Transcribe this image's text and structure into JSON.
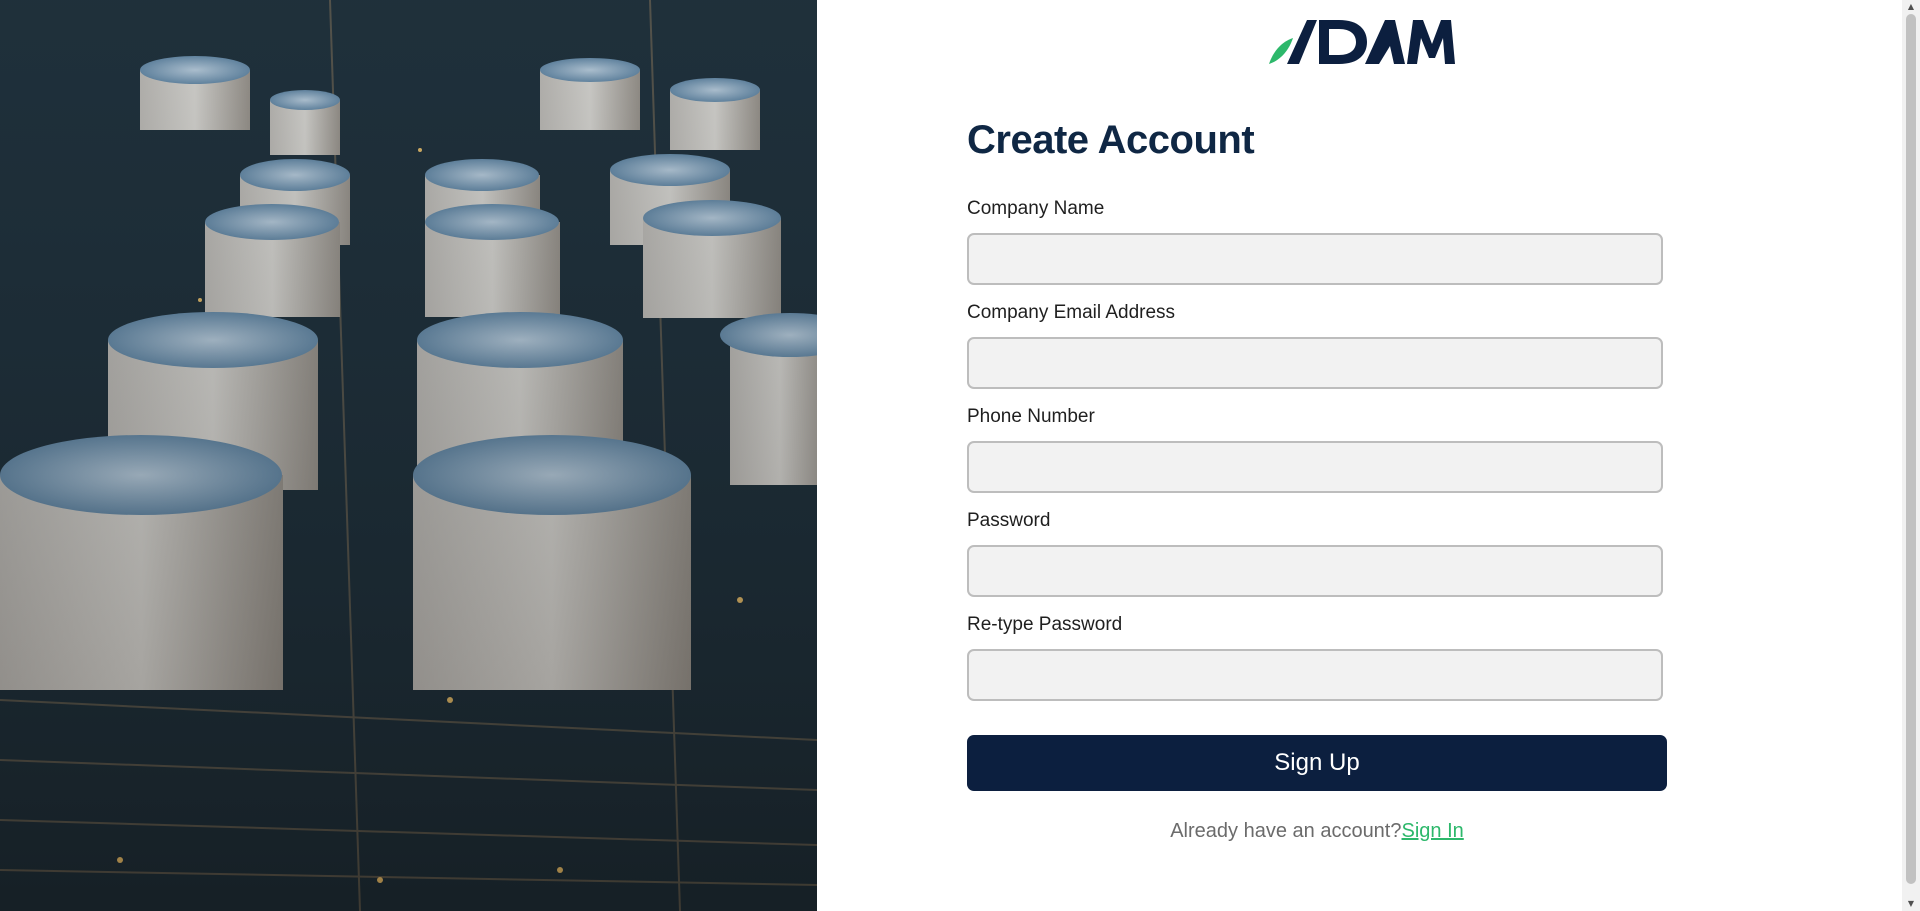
{
  "brand": {
    "logo_text": "ADAM",
    "accent_color": "#2db86b",
    "primary_color": "#0c1f3f"
  },
  "hero": {
    "image": "aerial-oil-storage-tanks-photo"
  },
  "form": {
    "title": "Create Account",
    "fields": [
      {
        "label": "Company Name",
        "value": "",
        "placeholder": ""
      },
      {
        "label": "Company Email Address",
        "value": "",
        "placeholder": ""
      },
      {
        "label": "Phone Number",
        "value": "",
        "placeholder": ""
      },
      {
        "label": "Password",
        "value": "",
        "placeholder": ""
      },
      {
        "label": "Re-type Password",
        "value": "",
        "placeholder": ""
      }
    ],
    "submit_label": "Sign Up",
    "signin_prompt": "Already have an account?",
    "signin_link": "Sign In"
  }
}
